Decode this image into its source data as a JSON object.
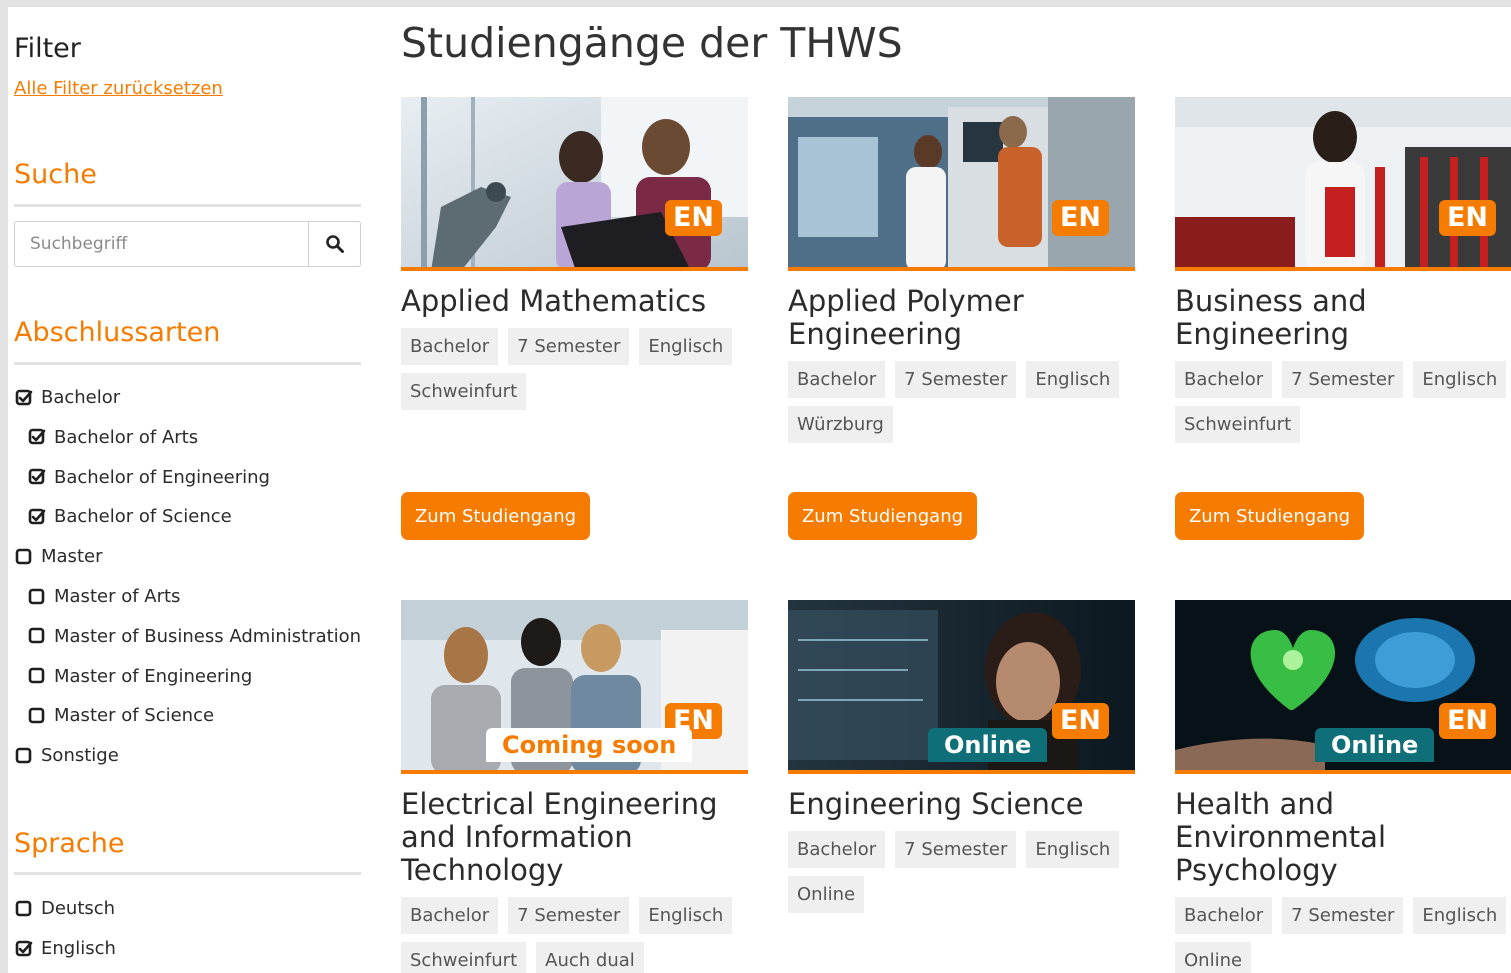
{
  "sidebar": {
    "filter_title": "Filter",
    "reset_label": "Alle Filter zurücksetzen",
    "search": {
      "title": "Suche",
      "placeholder": "Suchbegriff",
      "icon": "search-icon"
    },
    "degrees": {
      "title": "Abschlussarten",
      "options": [
        {
          "label": "Bachelor",
          "checked": true,
          "level": 0
        },
        {
          "label": "Bachelor of Arts",
          "checked": true,
          "level": 1
        },
        {
          "label": "Bachelor of Engineering",
          "checked": true,
          "level": 1
        },
        {
          "label": "Bachelor of Science",
          "checked": true,
          "level": 1
        },
        {
          "label": "Master",
          "checked": false,
          "level": 0
        },
        {
          "label": "Master of Arts",
          "checked": false,
          "level": 1
        },
        {
          "label": "Master of Business Administration",
          "checked": false,
          "level": 1
        },
        {
          "label": "Master of Engineering",
          "checked": false,
          "level": 1
        },
        {
          "label": "Master of Science",
          "checked": false,
          "level": 1
        },
        {
          "label": "Sonstige",
          "checked": false,
          "level": 0
        }
      ]
    },
    "language": {
      "title": "Sprache",
      "options": [
        {
          "label": "Deutsch",
          "checked": false
        },
        {
          "label": "Englisch",
          "checked": true
        }
      ]
    }
  },
  "main": {
    "title": "Studiengänge der THWS",
    "cta_label": "Zum Studiengang",
    "accent_color": "#f57c00",
    "online_color": "#0f6f78",
    "courses": [
      {
        "title_lines": [
          "Applied Mathematics"
        ],
        "badge": "EN",
        "status": "",
        "tags": [
          "Bachelor",
          "7 Semester",
          "Englisch",
          "Schweinfurt"
        ]
      },
      {
        "title_lines": [
          "Applied Polymer",
          "Engineering"
        ],
        "badge": "EN",
        "status": "",
        "tags": [
          "Bachelor",
          "7 Semester",
          "Englisch",
          "Würzburg"
        ]
      },
      {
        "title_lines": [
          "Business and",
          "Engineering"
        ],
        "badge": "EN",
        "status": "",
        "tags": [
          "Bachelor",
          "7 Semester",
          "Englisch",
          "Schweinfurt"
        ]
      },
      {
        "title_lines": [
          "Electrical Engineering",
          "and Information",
          "Technology"
        ],
        "badge": "EN",
        "status": "Coming soon",
        "tags": [
          "Bachelor",
          "7 Semester",
          "Englisch",
          "Schweinfurt",
          "Auch dual"
        ]
      },
      {
        "title_lines": [
          "Engineering Science"
        ],
        "badge": "EN",
        "status": "Online",
        "tags": [
          "Bachelor",
          "7 Semester",
          "Englisch",
          "Online"
        ]
      },
      {
        "title_lines": [
          "Health and",
          "Environmental",
          "Psychology"
        ],
        "badge": "EN",
        "status": "Online",
        "tags": [
          "Bachelor",
          "7 Semester",
          "Englisch",
          "Online"
        ]
      }
    ]
  }
}
